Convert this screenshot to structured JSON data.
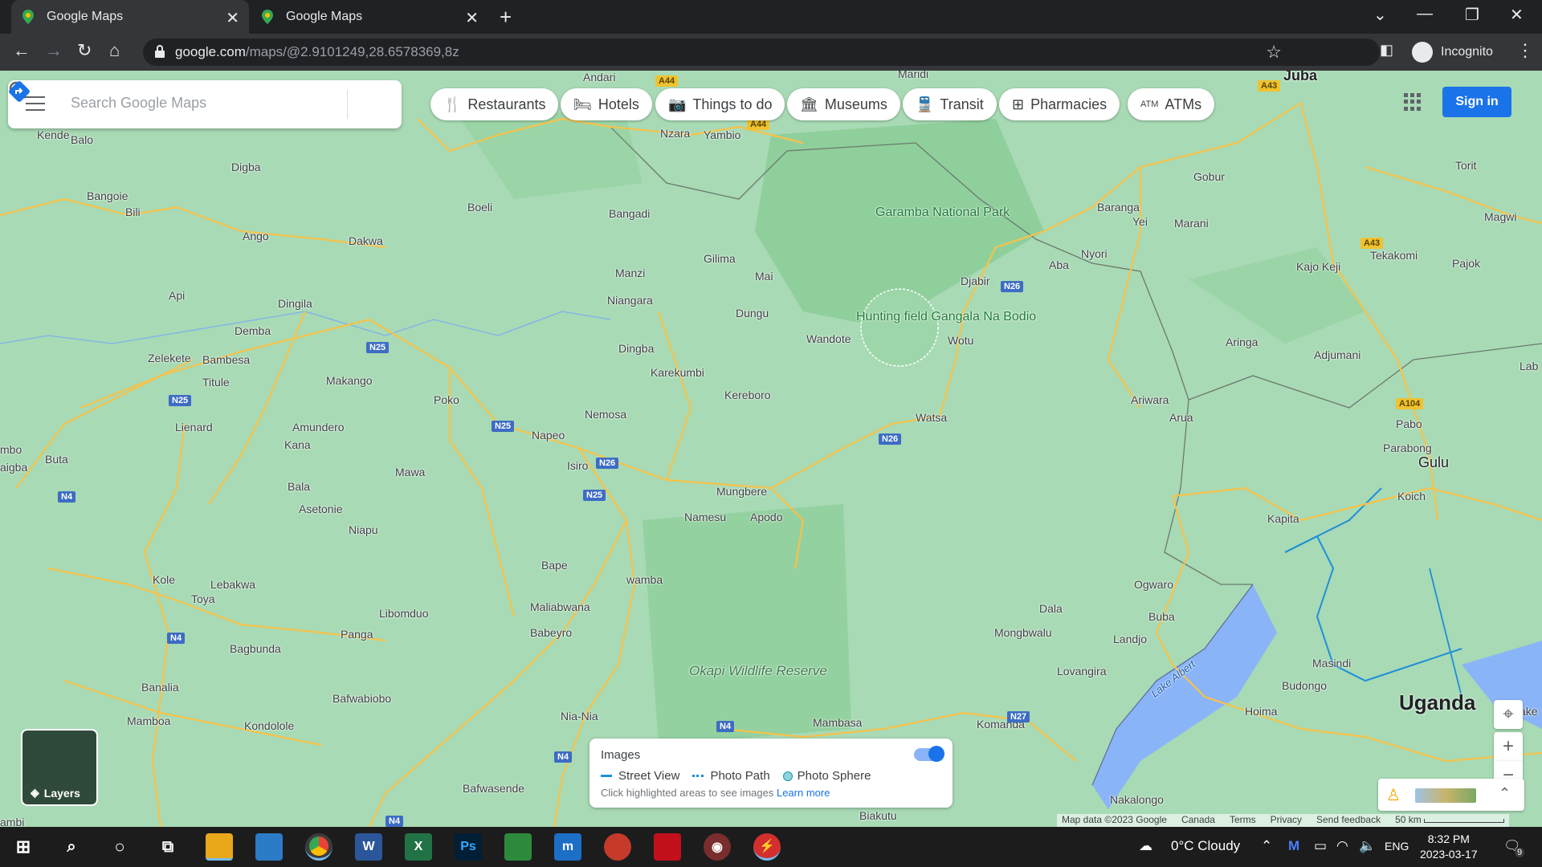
{
  "browser": {
    "tabs": [
      {
        "title": "Google Maps",
        "active": true
      },
      {
        "title": "Google Maps",
        "active": false
      }
    ],
    "url_host": "google.com",
    "url_path": "/maps/@2.9101249,28.6578369,8z",
    "profile_label": "Incognito"
  },
  "search": {
    "placeholder": "Search Google Maps"
  },
  "categories": [
    {
      "label": "Restaurants",
      "icon": "fork-knife-icon"
    },
    {
      "label": "Hotels",
      "icon": "bed-icon"
    },
    {
      "label": "Things to do",
      "icon": "camera-icon"
    },
    {
      "label": "Museums",
      "icon": "museum-icon"
    },
    {
      "label": "Transit",
      "icon": "train-icon"
    },
    {
      "label": "Pharmacies",
      "icon": "pharmacy-icon"
    },
    {
      "label": "ATMs",
      "icon": "atm-icon"
    }
  ],
  "signin_label": "Sign in",
  "layers_label": "Layers",
  "images_panel": {
    "title": "Images",
    "legend": [
      "Street View",
      "Photo Path",
      "Photo Sphere"
    ],
    "hint": "Click highlighted areas to see images",
    "learn_more": "Learn more"
  },
  "footer": {
    "map_data": "Map data ©2023 Google",
    "region": "Canada",
    "terms": "Terms",
    "privacy": "Privacy",
    "feedback": "Send feedback",
    "scale": "50 km"
  },
  "map_labels": {
    "andari": "Andari",
    "maridi": "Maridi",
    "juba": "Juba",
    "kende": "Kende",
    "balo": "Balo",
    "nzara": "Nzara",
    "yambio": "Yambio",
    "digba": "Digba",
    "bangoie": "Bangoie",
    "bili": "Bili",
    "boeli": "Boeli",
    "bangadi": "Bangadi",
    "garamba": "Garamba National Park",
    "gobur": "Gobur",
    "torit": "Torit",
    "baranga": "Baranga",
    "yei": "Yei",
    "marani": "Marani",
    "magwi": "Magwi",
    "ango": "Ango",
    "dakwa": "Dakwa",
    "gilima": "Gilima",
    "manzi": "Manzi",
    "mai": "Mai",
    "djabir": "Djabir",
    "aba": "Aba",
    "nyori": "Nyori",
    "kajokeji": "Kajo Keji",
    "tekakomi": "Tekakomi",
    "pajok": "Pajok",
    "api": "Api",
    "dingila": "Dingila",
    "niangara": "Niangara",
    "dungu": "Dungu",
    "hunting": "Hunting field Gangala Na Bodio",
    "wandote": "Wandote",
    "wotu": "Wotu",
    "aringa": "Aringa",
    "adjumani": "Adjumani",
    "demba": "Demba",
    "dingba": "Dingba",
    "zelekete": "Zelekete",
    "bambesa": "Bambesa",
    "titule": "Titule",
    "karekumbi": "Karekumbi",
    "makango": "Makango",
    "kereboro": "Kereboro",
    "poko": "Poko",
    "ariwara": "Ariwara",
    "arua": "Arua",
    "pabo": "Pabo",
    "nemosa": "Nemosa",
    "watsa": "Watsa",
    "lienard": "Lienard",
    "amundero": "Amundero",
    "napeo": "Napeo",
    "parabong": "Parabong",
    "gulu": "Gulu",
    "buta": "Buta",
    "kana": "Kana",
    "isiro": "Isiro",
    "mawa": "Mawa",
    "mungbere": "Mungbere",
    "koich": "Koich",
    "bala": "Bala",
    "asetonie": "Asetonie",
    "namesu": "Namesu",
    "apodo": "Apodo",
    "kapita": "Kapita",
    "niapu": "Niapu",
    "bape": "Bape",
    "wamba": "wamba",
    "kole": "Kole",
    "lebakwa": "Lebakwa",
    "toya": "Toya",
    "ogwaro": "Ogwaro",
    "maliabwana": "Maliabwana",
    "libomduo": "Libomduo",
    "dala": "Dala",
    "buba": "Buba",
    "babeyro": "Babeyro",
    "panga": "Panga",
    "bagbunda": "Bagbunda",
    "mongbwalu": "Mongbwalu",
    "landjo": "Landjo",
    "masindi": "Masindi",
    "okapi": "Okapi Wildlife Reserve",
    "lovangira": "Lovangira",
    "budongo": "Budongo",
    "banalia": "Banalia",
    "bafwabiobo": "Bafwabiobo",
    "uganda": "Uganda",
    "hoima": "Hoima",
    "lakealbert": "Lake Albert",
    "mamboa": "Mamboa",
    "kondolole": "Kondolole",
    "nianla": "Nia-Nia",
    "mambasa": "Mambasa",
    "komanda": "Komanda",
    "bafwasende": "Bafwasende",
    "nakalongo": "Nakalongo",
    "biakutu": "Biakutu",
    "aigba": "aigba",
    "mbo": "mbo",
    "lab": "Lab",
    "ake": "ake",
    "ambi": "ambi"
  },
  "shields": [
    "A44",
    "A44",
    "A43",
    "A43",
    "N25",
    "N25",
    "N25",
    "N26",
    "N26",
    "N26",
    "N25",
    "N4",
    "N4",
    "N4",
    "N4",
    "N4",
    "N27",
    "A104"
  ],
  "taskbar": {
    "weather": "0°C  Cloudy",
    "lang": "ENG",
    "time": "8:32 PM",
    "date": "2023-03-17",
    "notifications": "9"
  },
  "colors": {
    "land": "#a8dab5",
    "forest": "#8fcf9c",
    "water": "#8ab4f8",
    "road": "#f6c24a",
    "accent": "#1a73e8"
  }
}
